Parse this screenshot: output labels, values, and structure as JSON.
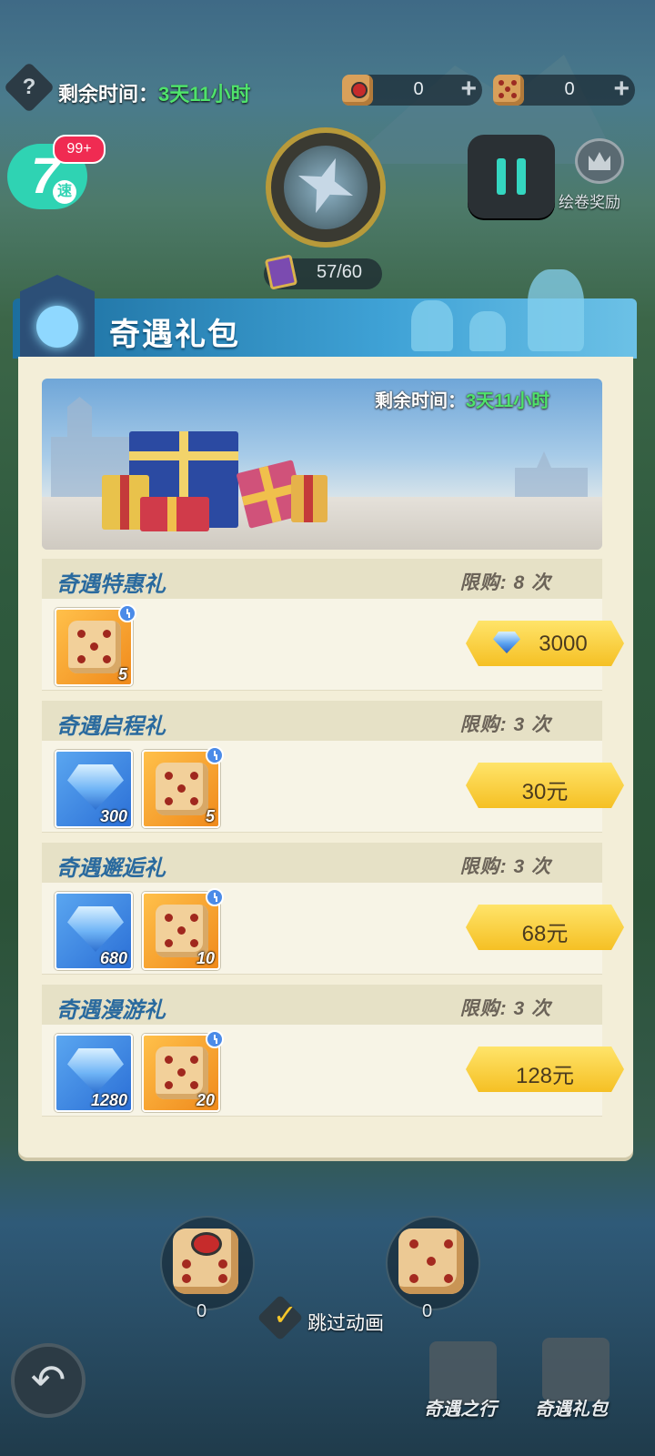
{
  "top": {
    "remaining_label": "剩余时间：",
    "remaining_value": "3天11小时",
    "red_dice_count": "0",
    "dice_count": "0",
    "speed_badge": "99+",
    "speed_number": "7",
    "speed_char": "速",
    "progress": "57/60",
    "reward_label": "绘卷奖励",
    "help_glyph": "?"
  },
  "banner": {
    "title": "奇遇礼包"
  },
  "hero": {
    "remaining_label": "剩余时间：",
    "remaining_value": "3天11小时"
  },
  "packs": [
    {
      "title": "奇遇特惠礼",
      "limit": "限购: 8 次",
      "price": "3000",
      "price_currency": "gem",
      "items": [
        {
          "type": "dice",
          "qty": "5"
        }
      ]
    },
    {
      "title": "奇遇启程礼",
      "limit": "限购: 3 次",
      "price": "30元",
      "items": [
        {
          "type": "gem",
          "qty": "300"
        },
        {
          "type": "dice",
          "qty": "5"
        }
      ]
    },
    {
      "title": "奇遇邂逅礼",
      "limit": "限购: 3 次",
      "price": "68元",
      "items": [
        {
          "type": "gem",
          "qty": "680"
        },
        {
          "type": "dice",
          "qty": "10"
        }
      ]
    },
    {
      "title": "奇遇漫游礼",
      "limit": "限购: 3 次",
      "price": "128元",
      "items": [
        {
          "type": "gem",
          "qty": "1280"
        },
        {
          "type": "dice",
          "qty": "20"
        }
      ]
    }
  ],
  "bottom": {
    "red_dice_count": "0",
    "dice_count": "0",
    "skip_label": "跳过动画",
    "nav": [
      {
        "label": "奇遇之行"
      },
      {
        "label": "奇遇礼包"
      }
    ]
  },
  "colors": {
    "accent_green": "#4fe36b",
    "title_blue": "#2a6a9e",
    "price_gold": "#f5c024",
    "speed_teal": "#2fd3b3"
  }
}
